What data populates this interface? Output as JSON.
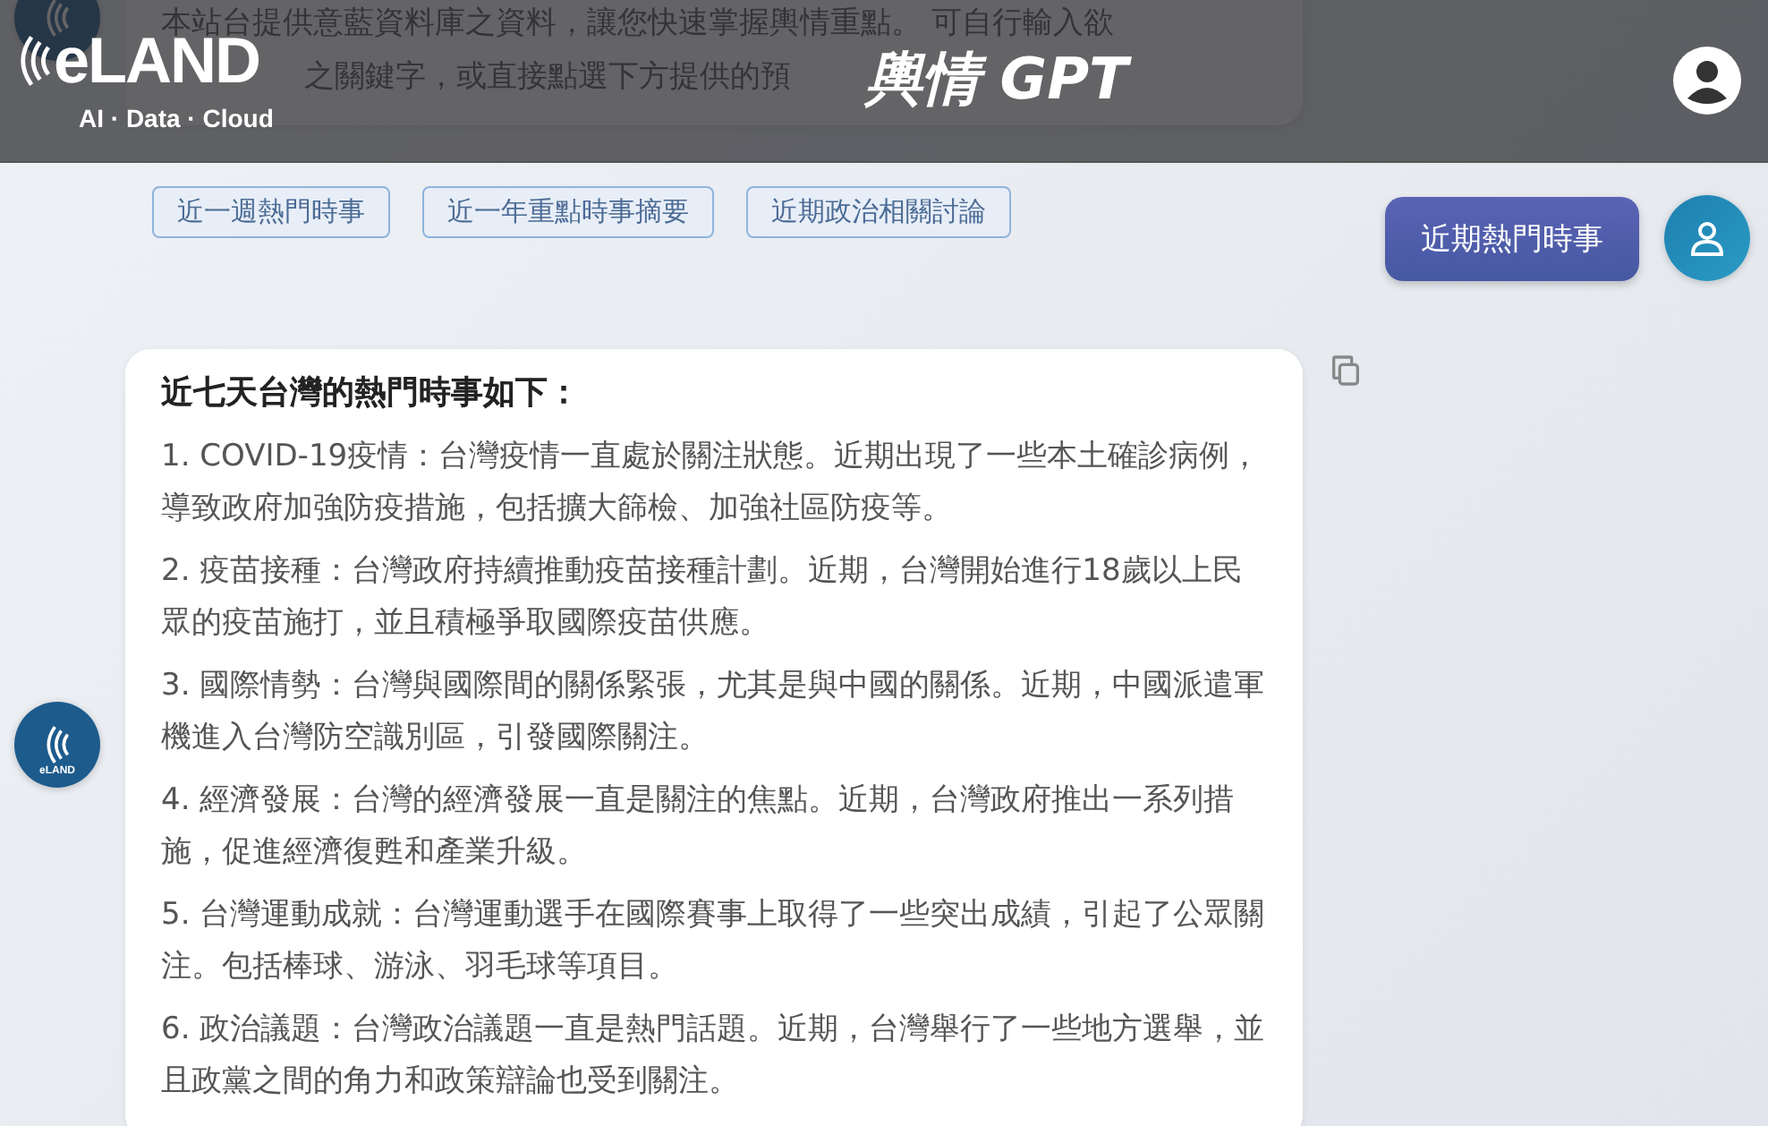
{
  "header": {
    "logo": {
      "name": "eLAND",
      "tagline": "AI · Data · Cloud"
    },
    "title": "輿情 GPT"
  },
  "intro_message": {
    "lines": [
      "本站台提供意藍資料庫之資料，讓您快速掌握輿情重點。 可自行輸入欲",
      "之關鍵字，或直接點選下方提供的預"
    ]
  },
  "suggestions": [
    "近一週熱門時事",
    "近一年重點時事摘要",
    "近期政治相關討論"
  ],
  "user_message": {
    "text": "近期熱門時事"
  },
  "bot_message": {
    "avatar_label": "eLAND",
    "heading": "近七天台灣的熱門時事如下：",
    "items": [
      "1. COVID-19疫情：台灣疫情一直處於關注狀態。近期出現了一些本土確診病例，導致政府加強防疫措施，包括擴大篩檢、加強社區防疫等。",
      "2. 疫苗接種：台灣政府持續推動疫苗接種計劃。近期，台灣開始進行18歲以上民眾的疫苗施打，並且積極爭取國際疫苗供應。",
      "3. 國際情勢：台灣與國際間的關係緊張，尤其是與中國的關係。近期，中國派遣軍機進入台灣防空識別區，引發國際關注。",
      "4. 經濟發展：台灣的經濟發展一直是關注的焦點。近期，台灣政府推出一系列措施，促進經濟復甦和產業升級。",
      "5. 台灣運動成就：台灣運動選手在國際賽事上取得了一些突出成績，引起了公眾關注。包括棒球、游泳、羽毛球等項目。",
      "6. 政治議題：台灣政治議題一直是熱門話題。近期，台灣舉行了一些地方選舉，並且政黨之間的角力和政策辯論也受到關注。"
    ]
  }
}
